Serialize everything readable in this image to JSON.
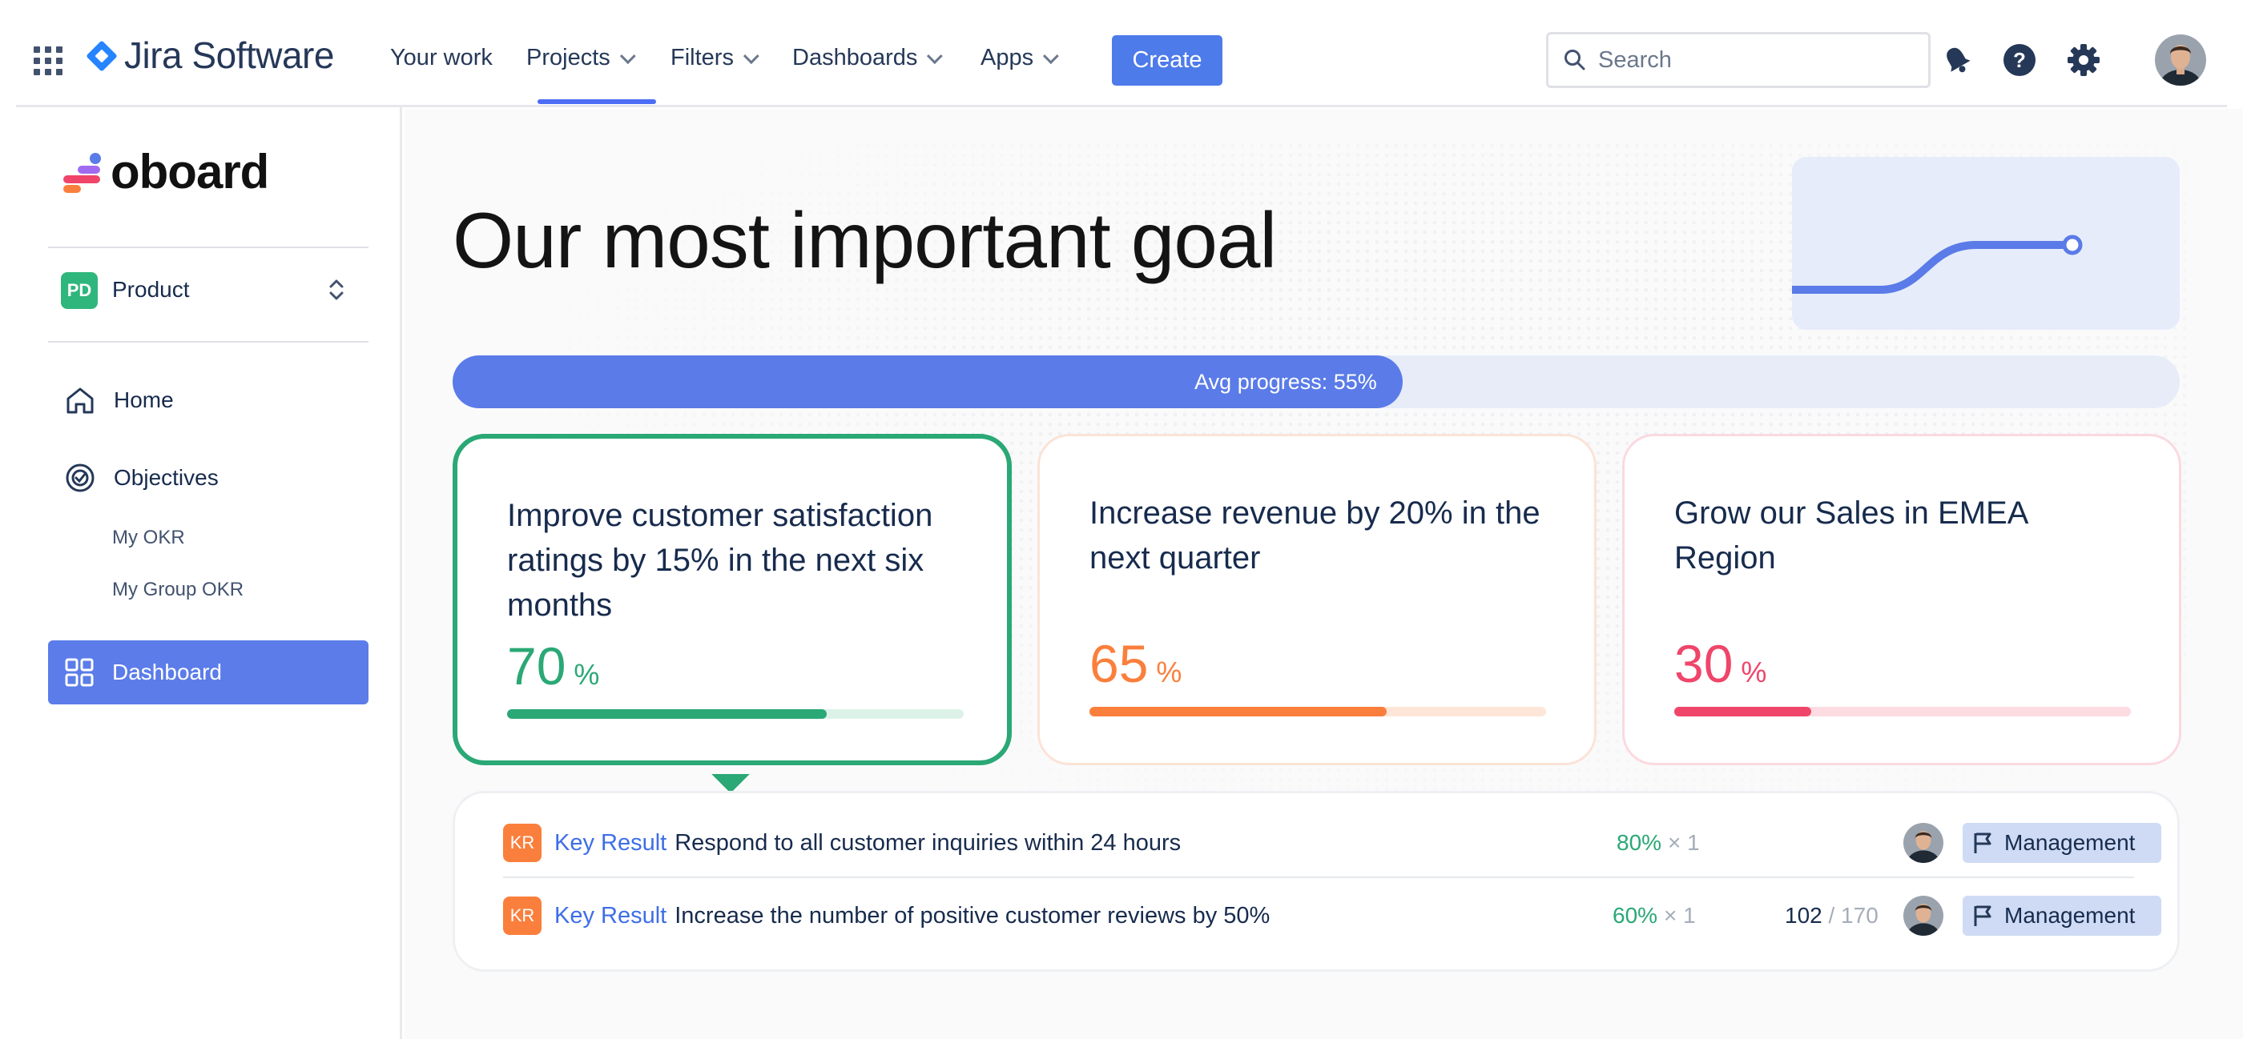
{
  "topnav": {
    "brand": "Jira Software",
    "items": [
      {
        "label": "Your work",
        "dropdown": false
      },
      {
        "label": "Projects",
        "dropdown": true,
        "active": true
      },
      {
        "label": "Filters",
        "dropdown": true
      },
      {
        "label": "Dashboards",
        "dropdown": true
      },
      {
        "label": "Apps",
        "dropdown": true
      }
    ],
    "create_label": "Create",
    "search_placeholder": "Search",
    "icons": [
      "app-switcher-icon",
      "notification-icon",
      "help-icon",
      "settings-icon"
    ]
  },
  "sidebar": {
    "app_name": "oboard",
    "project": {
      "badge": "PD",
      "name": "Product"
    },
    "items": [
      {
        "label": "Home",
        "icon": "home-icon"
      },
      {
        "label": "Objectives",
        "icon": "target-icon"
      }
    ],
    "sub_items": [
      "My OKR",
      "My Group OKR"
    ],
    "active_item": {
      "label": "Dashboard",
      "icon": "dashboard-grid-icon"
    }
  },
  "main": {
    "title": "Our most important goal",
    "avg_progress": {
      "label": "Avg progress: 55%",
      "value": 55
    },
    "objectives": [
      {
        "title": "Improve customer satisfaction ratings by 15% in the next six months",
        "percent": "70",
        "unit": "%",
        "progress": 70,
        "color": "#2aa875",
        "track": "#dcf2e8",
        "selected": true
      },
      {
        "title": "Increase revenue by 20% in the next quarter",
        "percent": "65",
        "unit": "%",
        "progress": 65,
        "color": "#fb7f3c",
        "track": "#fde6d8",
        "selected": false
      },
      {
        "title": "Grow our Sales in EMEA Region",
        "percent": "30",
        "unit": "%",
        "progress": 30,
        "color": "#f0456a",
        "track": "#fcdbe1",
        "selected": false
      }
    ],
    "key_results": [
      {
        "badge": "KR",
        "type": "Key Result",
        "text": "Respond to all customer inquiries within 24 hours",
        "percent": "80%",
        "multiplier": "× 1",
        "count": "",
        "of": "",
        "tag": "Management"
      },
      {
        "badge": "KR",
        "type": "Key Result",
        "text": "Increase the number of positive customer reviews by 50%",
        "percent": "60%",
        "multiplier": "× 1",
        "count": "102",
        "of": " / 170",
        "tag": "Management"
      }
    ]
  }
}
